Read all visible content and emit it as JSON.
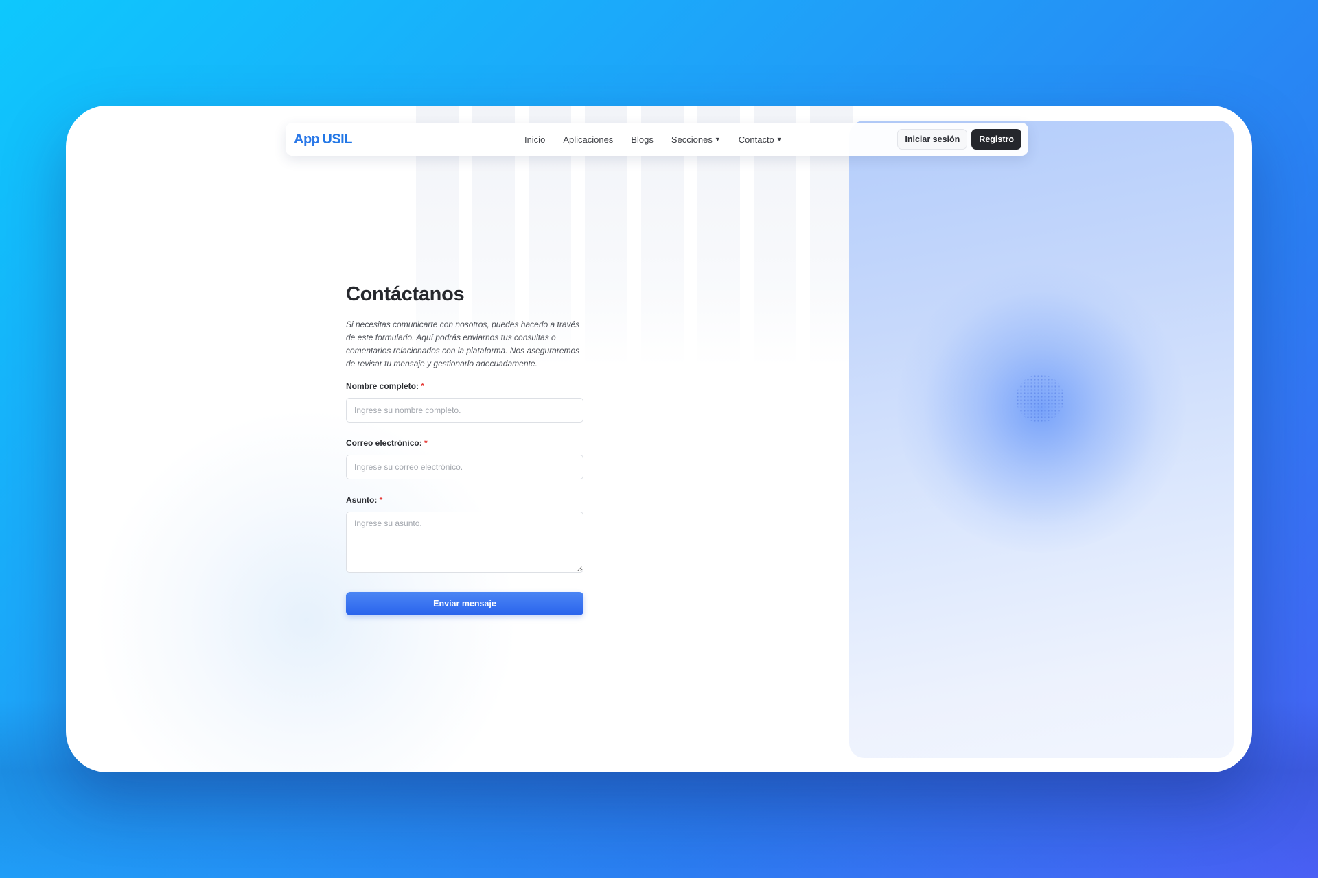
{
  "brand": {
    "part1": "App",
    "part2": "USIL",
    "color": "#2a78e8"
  },
  "nav": {
    "links": [
      {
        "label": "Inicio"
      },
      {
        "label": "Aplicaciones"
      },
      {
        "label": "Blogs"
      },
      {
        "label": "Secciones",
        "dropdown": true
      },
      {
        "label": "Contacto",
        "dropdown": true
      }
    ],
    "login_label": "Iniciar sesión",
    "register_label": "Registro"
  },
  "contact": {
    "title": "Contáctanos",
    "description": "Si necesitas comunicarte con nosotros, puedes hacerlo a través de este formulario. Aquí podrás enviarnos tus consultas o comentarios relacionados con la plataforma. Nos aseguraremos de revisar tu mensaje y gestionarlo adecuadamente.",
    "name_label": "Nombre completo:",
    "name_placeholder": "Ingrese su nombre completo.",
    "email_label": "Correo electrónico:",
    "email_placeholder": "Ingrese su correo electrónico.",
    "subject_label": "Asunto:",
    "subject_placeholder": "Ingrese su asunto.",
    "required_mark": "*",
    "submit_label": "Enviar mensaje"
  },
  "colors": {
    "background_start": "#0ec8fd",
    "background_end": "#4a5ff5",
    "primary_button": "#2a63ec",
    "register_button": "#25272c",
    "hero_panel": "#c6d8fb"
  },
  "icons": {
    "dropdown": "chevron-down-icon"
  }
}
